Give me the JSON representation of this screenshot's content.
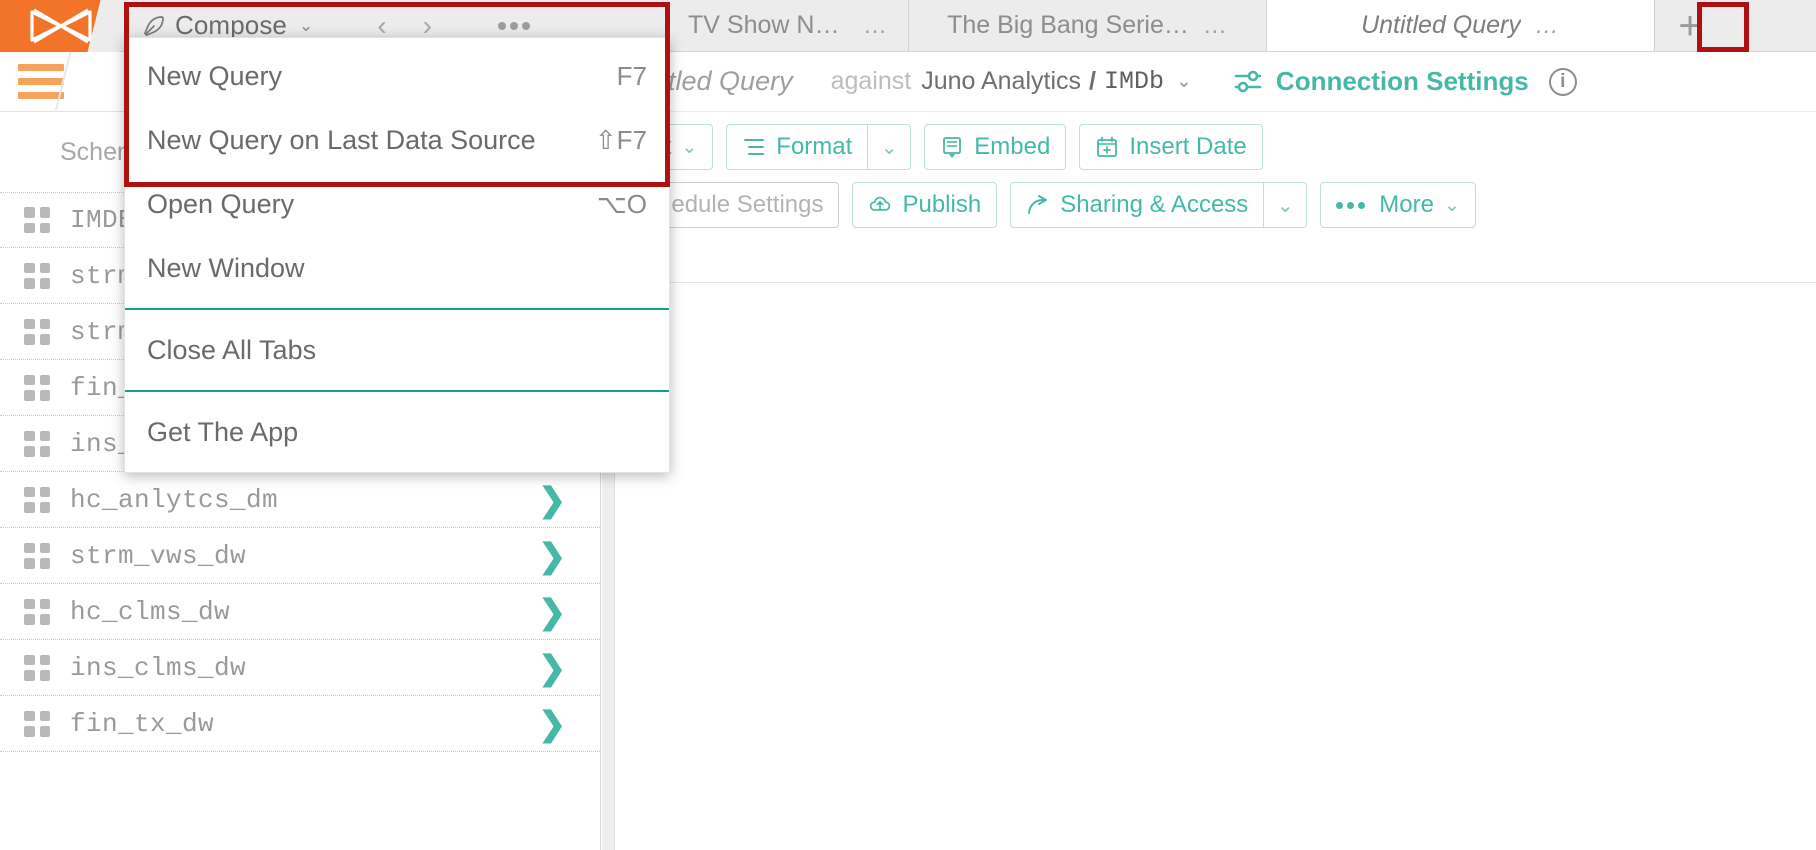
{
  "app": {
    "logo_name": "aqua-data-studio-logo",
    "accent_teal": "#46b8a8",
    "accent_orange": "#f2732a",
    "highlight_red": "#ad1111"
  },
  "tabstrip": {
    "compose": {
      "label": "Compose",
      "caret": "⌄",
      "icon": "feather-icon",
      "back_arrow": "‹",
      "forward_arrow": "›",
      "overflow": "•••"
    },
    "tabs": [
      {
        "title": "TV Show Number o…",
        "menu": "…",
        "active": false
      },
      {
        "title": "The Big Bang Serie…",
        "menu": "…",
        "active": false
      },
      {
        "title": "Untitled Query",
        "menu": "…",
        "active": true
      }
    ],
    "new_tab_label": "+"
  },
  "menu": {
    "items": [
      {
        "label": "New Query",
        "shortcut": "F7",
        "separator_after": false
      },
      {
        "label": "New Query on Last Data Source",
        "shortcut": "⇧F7",
        "separator_after": false
      },
      {
        "label": "Open Query",
        "shortcut": "⌥O",
        "separator_after": false
      },
      {
        "label": "New Window",
        "shortcut": "",
        "separator_after": true
      },
      {
        "label": "Close All Tabs",
        "shortcut": "",
        "separator_after": true
      },
      {
        "label": "Get The App",
        "shortcut": "",
        "separator_after": false
      }
    ]
  },
  "sidebar": {
    "description": "Schema objects are sorted alphabetically",
    "schemas": [
      {
        "name": "IMDB"
      },
      {
        "name": "strm_anlytcs_dm"
      },
      {
        "name": "strm_clms_dm"
      },
      {
        "name": "fin_anlytcs_dm"
      },
      {
        "name": "ins_anlytcs_dm"
      },
      {
        "name": "hc_anlytcs_dm"
      },
      {
        "name": "strm_vws_dw"
      },
      {
        "name": "hc_clms_dw"
      },
      {
        "name": "ins_clms_dw"
      },
      {
        "name": "fin_tx_dw"
      }
    ],
    "chevron": "❯"
  },
  "query_header": {
    "title": "Untitled Query",
    "against_label": "against",
    "datasource": "Juno Analytics",
    "separator": "/",
    "database": "IMDb",
    "db_caret": "⌄",
    "connection_settings": "Connection Settings",
    "info_icon": "i"
  },
  "toolbar": {
    "row1": [
      {
        "label": "Edit",
        "icon": "",
        "split": false,
        "caret": "⌄",
        "disabled": false
      },
      {
        "label": "Format",
        "icon": "format-icon",
        "split": true,
        "caret": "⌄",
        "disabled": false
      },
      {
        "label": "Embed",
        "icon": "embed-icon",
        "split": false,
        "caret": "",
        "disabled": false
      },
      {
        "label": "Insert Date",
        "icon": "calendar-icon",
        "split": false,
        "caret": "",
        "disabled": false
      }
    ],
    "row2": [
      {
        "label": "Schedule Settings",
        "icon": "",
        "split": false,
        "caret": "",
        "disabled": true
      },
      {
        "label": "Publish",
        "icon": "publish-icon",
        "split": false,
        "caret": "",
        "disabled": false
      },
      {
        "label": "Sharing & Access",
        "icon": "share-icon",
        "split": true,
        "caret": "⌄",
        "disabled": false
      },
      {
        "label": "More",
        "icon": "dots-icon",
        "split": false,
        "caret": "⌄",
        "disabled": false
      }
    ]
  }
}
